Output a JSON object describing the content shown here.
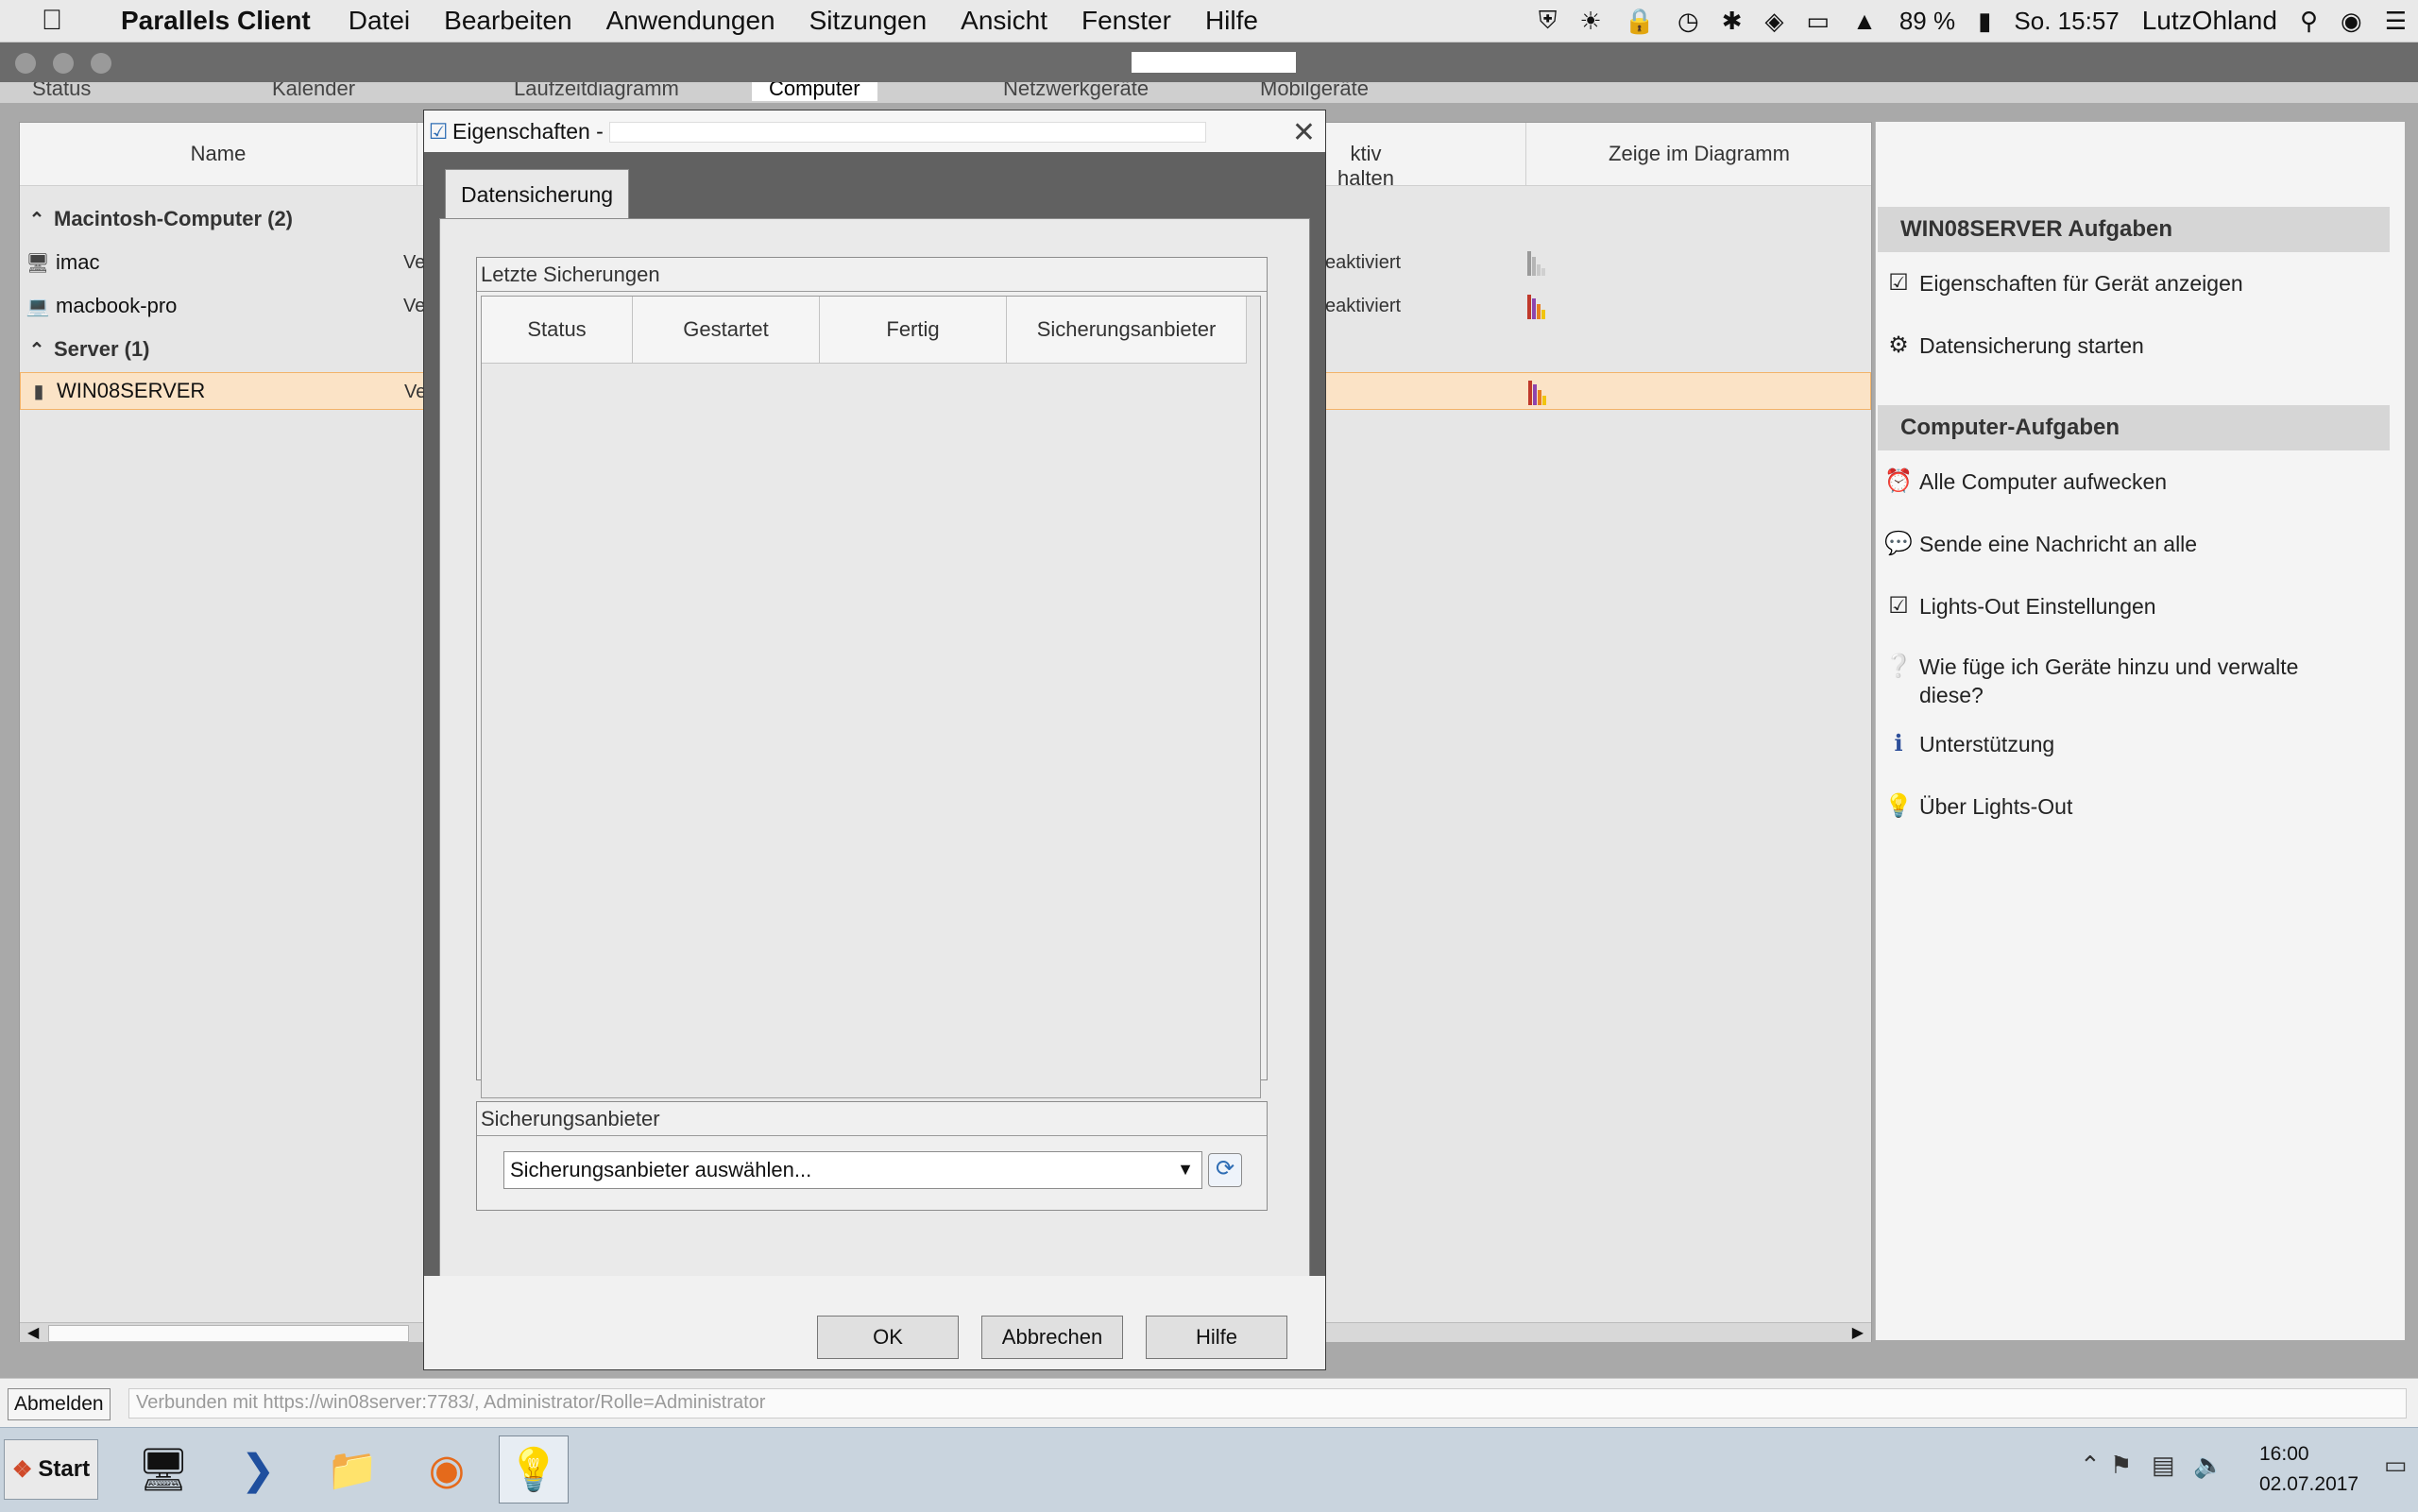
{
  "menubar": {
    "apple": "",
    "app_name": "Parallels Client",
    "items": [
      "Datei",
      "Bearbeiten",
      "Anwendungen",
      "Sitzungen",
      "Ansicht",
      "Fenster",
      "Hilfe"
    ],
    "battery": "89 %",
    "datetime": "So. 15:57",
    "user": "LutzOhland"
  },
  "remote_tabs": [
    "Status",
    "Kalender",
    "Laufzeitdiagramm",
    "Computer",
    "Netzwerkgeräte",
    "Mobilgeräte"
  ],
  "device_table": {
    "columns": [
      "Name",
      "ktiv halten",
      "Zeige im Diagramm"
    ],
    "groups": [
      {
        "label": "Macintosh-Computer (2)"
      },
      {
        "label": "Server (1)"
      }
    ],
    "rows": [
      {
        "name": "imac",
        "status": "Ve",
        "keep_active": "eaktiviert"
      },
      {
        "name": "macbook-pro",
        "status": "Ve",
        "keep_active": "eaktiviert"
      },
      {
        "name": "WIN08SERVER",
        "status": "Ve",
        "keep_active": ""
      }
    ]
  },
  "task_pane": {
    "section1_title": "WIN08SERVER Aufgaben",
    "section1_items": [
      "Eigenschaften für Gerät anzeigen",
      "Datensicherung starten"
    ],
    "section2_title": "Computer-Aufgaben",
    "section2_items": [
      "Alle Computer aufwecken",
      "Sende eine Nachricht an alle",
      "Lights-Out Einstellungen",
      "Wie füge ich Geräte hinzu und verwalte diese?",
      "Unterstützung",
      "Über Lights-Out"
    ]
  },
  "dialog": {
    "title": "Eigenschaften -",
    "tab": "Datensicherung",
    "last_backups_label": "Letzte Sicherungen",
    "list_columns": [
      "Status",
      "Gestartet",
      "Fertig",
      "Sicherungsanbieter"
    ],
    "provider_label": "Sicherungsanbieter",
    "provider_select_value": "Sicherungsanbieter auswählen...",
    "buttons": {
      "ok": "OK",
      "cancel": "Abbrechen",
      "help": "Hilfe"
    }
  },
  "statusbar": {
    "logout": "Abmelden",
    "connection": "Verbunden mit https://win08server:7783/, Administrator/Rolle=Administrator"
  },
  "taskbar": {
    "start": "Start",
    "clock_time": "16:00",
    "clock_date": "02.07.2017"
  },
  "colors": {
    "selection": "#fbe3c6",
    "dialog_frame": "#616161",
    "taskbar": "#c9d4de"
  }
}
